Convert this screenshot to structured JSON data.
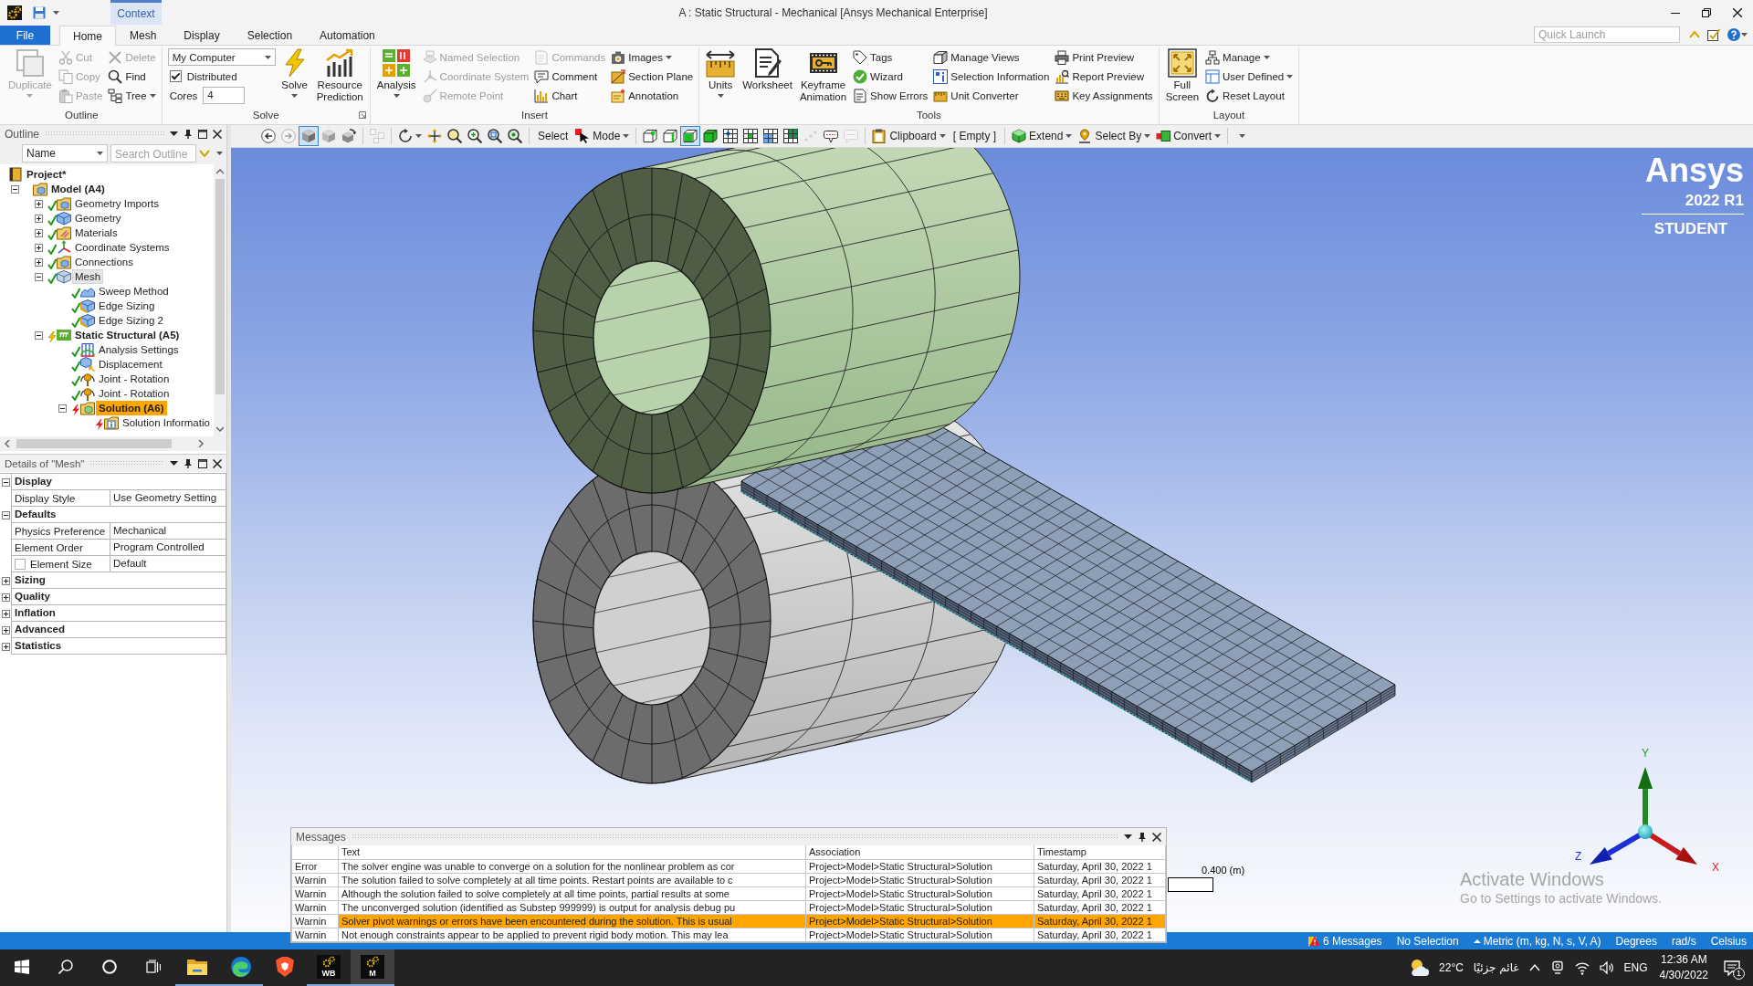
{
  "title_bar": {
    "context_tab": "Context",
    "title": "A : Static Structural - Mechanical [Ansys Mechanical Enterprise]"
  },
  "ribbon_tabs": [
    {
      "label": "File",
      "kind": "file",
      "selected": false
    },
    {
      "label": "Home",
      "kind": "tab",
      "selected": true
    },
    {
      "label": "Mesh",
      "kind": "tab",
      "selected": false
    },
    {
      "label": "Display",
      "kind": "tab",
      "selected": false
    },
    {
      "label": "Selection",
      "kind": "tab",
      "selected": false
    },
    {
      "label": "Automation",
      "kind": "tab",
      "selected": false
    }
  ],
  "quick_launch": {
    "placeholder": "Quick Launch"
  },
  "ribbon_groups": [
    {
      "label": "Outline",
      "launcher": false,
      "columns": [
        [
          {
            "kind": "big",
            "label": "Duplicate",
            "disabled": true,
            "dropdown": true
          }
        ],
        [
          {
            "kind": "small",
            "label": "Cut",
            "disabled": true,
            "dropdown": false
          },
          {
            "kind": "small",
            "label": "Copy",
            "disabled": true,
            "dropdown": false
          },
          {
            "kind": "small",
            "label": "Paste",
            "disabled": true,
            "dropdown": false
          }
        ],
        [
          {
            "kind": "small",
            "label": "Delete",
            "disabled": true,
            "dropdown": false
          },
          {
            "kind": "small",
            "label": "Find",
            "disabled": false,
            "dropdown": false
          },
          {
            "kind": "small",
            "label": "Tree",
            "disabled": false,
            "dropdown": true
          }
        ]
      ]
    },
    {
      "label": "Solve",
      "launcher": true,
      "columns": [
        [
          {
            "kind": "combo",
            "value": "My Computer"
          },
          {
            "kind": "check",
            "label": "Distributed",
            "checked": true
          },
          {
            "kind": "field",
            "label": "Cores",
            "value": "4"
          }
        ],
        [
          {
            "kind": "big",
            "label": "Solve",
            "disabled": false,
            "dropdown": true
          }
        ],
        [
          {
            "kind": "big",
            "label": "Resource Prediction",
            "disabled": false,
            "dropdown": false
          }
        ]
      ]
    },
    {
      "label": "Insert",
      "launcher": false,
      "columns": [
        [
          {
            "kind": "big",
            "label": "Analysis",
            "disabled": false,
            "dropdown": true
          }
        ],
        [
          {
            "kind": "small",
            "label": "Named Selection",
            "disabled": true,
            "dropdown": false
          },
          {
            "kind": "small",
            "label": "Coordinate System",
            "disabled": true,
            "dropdown": false
          },
          {
            "kind": "small",
            "label": "Remote Point",
            "disabled": true,
            "dropdown": false
          }
        ],
        [
          {
            "kind": "small",
            "label": "Commands",
            "disabled": true,
            "dropdown": false
          },
          {
            "kind": "small",
            "label": "Comment",
            "disabled": false,
            "dropdown": false
          },
          {
            "kind": "small",
            "label": "Chart",
            "disabled": false,
            "dropdown": false
          }
        ],
        [
          {
            "kind": "small",
            "label": "Images",
            "disabled": false,
            "dropdown": true
          },
          {
            "kind": "small",
            "label": "Section Plane",
            "disabled": false,
            "dropdown": false
          },
          {
            "kind": "small",
            "label": "Annotation",
            "disabled": false,
            "dropdown": false
          }
        ]
      ]
    },
    {
      "label": "Tools",
      "launcher": false,
      "columns": [
        [
          {
            "kind": "big",
            "label": "Units",
            "disabled": false,
            "dropdown": true
          }
        ],
        [
          {
            "kind": "big",
            "label": "Worksheet",
            "disabled": false,
            "dropdown": false
          }
        ],
        [
          {
            "kind": "big",
            "label": "Keyframe Animation",
            "disabled": false,
            "dropdown": false
          }
        ],
        [
          {
            "kind": "small",
            "label": "Tags",
            "disabled": false,
            "dropdown": false
          },
          {
            "kind": "small",
            "label": "Wizard",
            "disabled": false,
            "dropdown": false
          },
          {
            "kind": "small",
            "label": "Show Errors",
            "disabled": false,
            "dropdown": false
          }
        ],
        [
          {
            "kind": "small",
            "label": "Manage Views",
            "disabled": false,
            "dropdown": false
          },
          {
            "kind": "small",
            "label": "Selection Information",
            "disabled": false,
            "dropdown": false
          },
          {
            "kind": "small",
            "label": "Unit Converter",
            "disabled": false,
            "dropdown": false
          }
        ],
        [
          {
            "kind": "small",
            "label": "Print Preview",
            "disabled": false,
            "dropdown": false
          },
          {
            "kind": "small",
            "label": "Report Preview",
            "disabled": false,
            "dropdown": false
          },
          {
            "kind": "small",
            "label": "Key Assignments",
            "disabled": false,
            "dropdown": false
          }
        ]
      ]
    },
    {
      "label": "Layout",
      "launcher": false,
      "columns": [
        [
          {
            "kind": "big",
            "label": "Full Screen",
            "disabled": false,
            "dropdown": false
          }
        ],
        [
          {
            "kind": "small",
            "label": "Manage",
            "disabled": false,
            "dropdown": true
          },
          {
            "kind": "small",
            "label": "User Defined",
            "disabled": false,
            "dropdown": true
          },
          {
            "kind": "small",
            "label": "Reset Layout",
            "disabled": false,
            "dropdown": false
          }
        ]
      ]
    }
  ],
  "graphics_toolbar": [
    [
      {
        "kind": "icon",
        "selected": false,
        "disabled": false
      },
      {
        "kind": "icon",
        "selected": false,
        "disabled": true
      },
      {
        "kind": "icon",
        "selected": true,
        "disabled": false
      },
      {
        "kind": "icon",
        "selected": false,
        "disabled": false
      },
      {
        "kind": "icon",
        "selected": false,
        "disabled": false
      }
    ],
    [
      {
        "kind": "icon",
        "selected": false,
        "disabled": true
      }
    ],
    [
      {
        "kind": "iconmenu",
        "selected": false,
        "disabled": false
      },
      {
        "kind": "icon",
        "selected": false,
        "disabled": false
      },
      {
        "kind": "icon",
        "selected": false,
        "disabled": false
      },
      {
        "kind": "icon",
        "selected": false,
        "disabled": false
      },
      {
        "kind": "icon",
        "selected": false,
        "disabled": false
      },
      {
        "kind": "icon",
        "selected": false,
        "disabled": false
      }
    ],
    [
      {
        "kind": "text",
        "label": "Select"
      },
      {
        "kind": "menu",
        "label": "Mode"
      }
    ],
    [
      {
        "kind": "icon",
        "selected": false,
        "disabled": false
      },
      {
        "kind": "icon",
        "selected": false,
        "disabled": false
      },
      {
        "kind": "icon",
        "selected": true,
        "disabled": false
      },
      {
        "kind": "icon",
        "selected": false,
        "disabled": false
      },
      {
        "kind": "icon",
        "selected": false,
        "disabled": false
      },
      {
        "kind": "icon",
        "selected": false,
        "disabled": false
      },
      {
        "kind": "icon",
        "selected": false,
        "disabled": false
      },
      {
        "kind": "icon",
        "selected": false,
        "disabled": false
      },
      {
        "kind": "icon",
        "selected": false,
        "disabled": true
      },
      {
        "kind": "icon",
        "selected": false,
        "disabled": false
      },
      {
        "kind": "icon",
        "selected": false,
        "disabled": true
      }
    ],
    [
      {
        "kind": "menu",
        "label": "Clipboard"
      },
      {
        "kind": "text",
        "label": "[ Empty ]"
      }
    ],
    [
      {
        "kind": "menu",
        "label": "Extend"
      },
      {
        "kind": "menu",
        "label": "Select By"
      },
      {
        "kind": "menu",
        "label": "Convert"
      }
    ],
    [
      {
        "kind": "overflow"
      }
    ]
  ],
  "outline": {
    "title": "Outline",
    "filter": "Name",
    "search": {
      "placeholder": "Search Outline"
    },
    "tree": [
      {
        "label": "Project*",
        "kind": "major",
        "selected": false,
        "highlighted": false,
        "children": [
          {
            "label": "Model (A4)",
            "kind": "major",
            "expanded": true,
            "selected": false,
            "highlighted": false,
            "children": [
              {
                "label": "Geometry Imports",
                "kind": "minor",
                "solved": true,
                "expanded": false,
                "selected": false,
                "highlighted": false
              },
              {
                "label": "Geometry",
                "kind": "minor",
                "solved": true,
                "expanded": false,
                "selected": false,
                "highlighted": false
              },
              {
                "label": "Materials",
                "kind": "minor",
                "solved": true,
                "expanded": false,
                "selected": false,
                "highlighted": false
              },
              {
                "label": "Coordinate Systems",
                "kind": "minor",
                "solved": true,
                "expanded": false,
                "selected": false,
                "highlighted": false
              },
              {
                "label": "Connections",
                "kind": "minor",
                "solved": true,
                "expanded": false,
                "selected": false,
                "highlighted": false
              },
              {
                "label": "Mesh",
                "kind": "minor",
                "solved": true,
                "expanded": true,
                "selected": true,
                "highlighted": false,
                "children": [
                  {
                    "label": "Sweep Method",
                    "kind": "minor",
                    "solved": true,
                    "selected": false,
                    "highlighted": false
                  },
                  {
                    "label": "Edge Sizing",
                    "kind": "minor",
                    "solved": true,
                    "selected": false,
                    "highlighted": false
                  },
                  {
                    "label": "Edge Sizing 2",
                    "kind": "minor",
                    "solved": true,
                    "selected": false,
                    "highlighted": false
                  }
                ]
              },
              {
                "label": "Static Structural (A5)",
                "kind": "major",
                "solved": false,
                "failed": false,
                "expanded": true,
                "selected": false,
                "highlighted": false,
                "children": [
                  {
                    "label": "Analysis Settings",
                    "kind": "minor",
                    "solved": true,
                    "selected": false,
                    "highlighted": false
                  },
                  {
                    "label": "Displacement",
                    "kind": "minor",
                    "solved": true,
                    "selected": false,
                    "highlighted": false
                  },
                  {
                    "label": "Joint - Rotation",
                    "kind": "minor",
                    "solved": true,
                    "selected": false,
                    "highlighted": false
                  },
                  {
                    "label": "Joint - Rotation",
                    "kind": "minor",
                    "solved": true,
                    "selected": false,
                    "highlighted": false
                  },
                  {
                    "label": "Solution (A6)",
                    "kind": "major",
                    "solved": false,
                    "failed": true,
                    "expanded": true,
                    "selected": false,
                    "highlighted": true,
                    "children": [
                      {
                        "label": "Solution Informatio",
                        "kind": "minor",
                        "solved": false,
                        "failed": true,
                        "selected": false,
                        "highlighted": false
                      }
                    ]
                  }
                ]
              }
            ]
          }
        ]
      }
    ]
  },
  "details": {
    "title": "Details of \"Mesh\"",
    "groups": [
      {
        "label": "Display",
        "expanded": true,
        "rows": [
          {
            "kind": "plain",
            "label": "Display Style",
            "value": "Use Geometry Setting"
          }
        ]
      },
      {
        "label": "Defaults",
        "expanded": true,
        "rows": [
          {
            "kind": "plain",
            "label": "Physics Preference",
            "value": "Mechanical"
          },
          {
            "kind": "plain",
            "label": "Element Order",
            "value": "Program Controlled"
          },
          {
            "kind": "check",
            "label": "Element Size",
            "value": "Default",
            "checked": false
          }
        ]
      },
      {
        "label": "Sizing",
        "expanded": false
      },
      {
        "label": "Quality",
        "expanded": false
      },
      {
        "label": "Inflation",
        "expanded": false
      },
      {
        "label": "Advanced",
        "expanded": false
      },
      {
        "label": "Statistics",
        "expanded": false
      }
    ]
  },
  "viewport": {
    "logo": {
      "brand": "Ansys",
      "release": "2022 R1",
      "edition": "STUDENT"
    },
    "triad": {
      "y": "Y",
      "x": "X",
      "z": "Z"
    },
    "scale_bar": "0.400 (m)"
  },
  "activation_notice": {
    "title": "Activate Windows",
    "hint": "Go to Settings to activate Windows."
  },
  "messages": {
    "title": "Messages",
    "columns": [
      "Text",
      "Association",
      "Timestamp"
    ],
    "rows": [
      {
        "type": "Error",
        "text": "The solver engine was unable to converge on a solution for the nonlinear problem as cor",
        "association": "Project>Model>Static Structural>Solution",
        "timestamp": "Saturday, April 30, 2022 1",
        "selected": false
      },
      {
        "type": "Warnin",
        "text": "The solution failed to solve completely at all time points. Restart points are available to c",
        "association": "Project>Model>Static Structural>Solution",
        "timestamp": "Saturday, April 30, 2022 1",
        "selected": false
      },
      {
        "type": "Warnin",
        "text": "Although the solution failed to solve completely at all time points, partial results at some",
        "association": "Project>Model>Static Structural>Solution",
        "timestamp": "Saturday, April 30, 2022 1",
        "selected": false
      },
      {
        "type": "Warnin",
        "text": "The unconverged solution (identified as Substep 999999) is output for analysis debug pu",
        "association": "Project>Model>Static Structural>Solution",
        "timestamp": "Saturday, April 30, 2022 1",
        "selected": false
      },
      {
        "type": "Warnin",
        "text": "Solver pivot warnings or errors have been encountered during the solution.  This is usual",
        "association": "Project>Model>Static Structural>Solution",
        "timestamp": "Saturday, April 30, 2022 1",
        "selected": true
      },
      {
        "type": "Warnin",
        "text": "Not enough constraints appear to be applied to prevent rigid body motion. This may lea",
        "association": "Project>Model>Static Structural>Solution",
        "timestamp": "Saturday, April 30, 2022 1",
        "selected": false
      }
    ]
  },
  "status_bar": {
    "messages": "6 Messages",
    "selection": "No Selection",
    "units": "Metric (m, kg, N, s, V, A)",
    "angle": "Degrees",
    "rotational_velocity": "rad/s",
    "temperature": "Celsius"
  },
  "taskbar": {
    "apps": [
      {
        "kind": "plain",
        "running": true,
        "active": false
      },
      {
        "kind": "plain",
        "running": true,
        "active": false
      },
      {
        "kind": "plain",
        "running": false,
        "active": false
      },
      {
        "kind": "lettered",
        "label": "WB",
        "running": true,
        "active": false
      },
      {
        "kind": "lettered",
        "label": "M",
        "running": true,
        "active": true
      }
    ],
    "tray": {
      "temperature": "22°C",
      "weather": "غائم جزئيًا",
      "language": "ENG",
      "time": "12:36 AM",
      "date": "4/30/2022",
      "notifications": "1"
    }
  }
}
